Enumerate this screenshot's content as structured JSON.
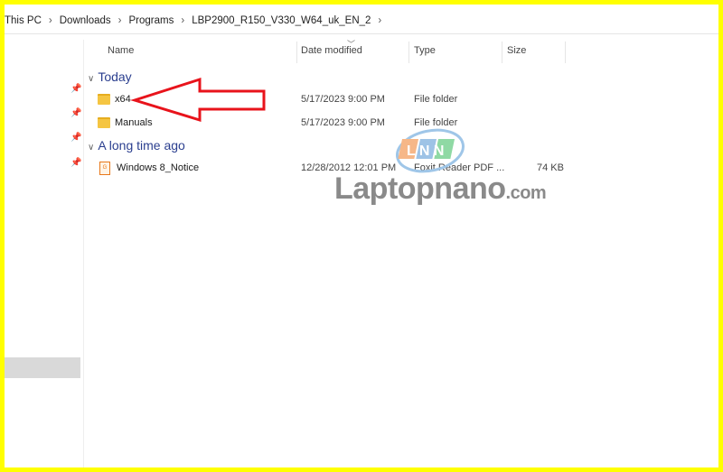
{
  "breadcrumb": [
    "This PC",
    "Downloads",
    "Programs",
    "LBP2900_R150_V330_W64_uk_EN_2"
  ],
  "columns": {
    "name": "Name",
    "date": "Date modified",
    "type": "Type",
    "size": "Size"
  },
  "groups": [
    {
      "label": "Today",
      "items": [
        {
          "name": "x64",
          "date": "5/17/2023 9:00 PM",
          "type": "File folder",
          "size": "",
          "icon": "folder-icon"
        },
        {
          "name": "Manuals",
          "date": "5/17/2023 9:00 PM",
          "type": "File folder",
          "size": "",
          "icon": "folder-icon"
        }
      ]
    },
    {
      "label": "A long time ago",
      "items": [
        {
          "name": "Windows 8_Notice",
          "date": "12/28/2012 12:01 PM",
          "type": "Foxit Reader PDF ...",
          "size": "74 KB",
          "icon": "pdf-icon"
        }
      ]
    }
  ],
  "watermark": {
    "text": "Laptopnano",
    "suffix": ".com",
    "logo": "LNN"
  },
  "colors": {
    "border": "#ffff00",
    "arrow": "#e8131b",
    "group": "#2b3f8f"
  }
}
